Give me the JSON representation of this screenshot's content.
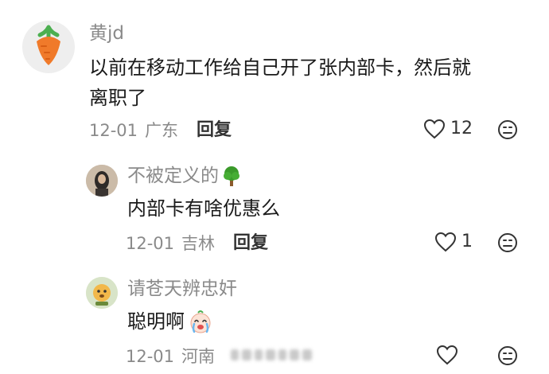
{
  "comments": [
    {
      "user": "黄jd",
      "text_line1": "以前在移动工作给自己开了张内部卡，然后就",
      "text_line2": "离职了",
      "date": "12-01",
      "location": "广东",
      "reply_label": "回复",
      "likes": "12"
    }
  ],
  "replies": [
    {
      "user": "不被定义的",
      "text": "内部卡有啥优惠么",
      "date": "12-01",
      "location": "吉林",
      "reply_label": "回复",
      "likes": "1"
    },
    {
      "user": "请苍天辨忠奸",
      "text": "聪明啊",
      "date": "12-01",
      "location": "河南",
      "likes": ""
    }
  ],
  "icons": {
    "like": "heart-outline-icon",
    "dislike": "sad-face-icon",
    "tree_badge": "tree-emoji",
    "cry_emoji": "crying-face-emoji",
    "carrot_avatar": "carrot-avatar"
  },
  "colors": {
    "text": "#1a1a1a",
    "meta": "#8a8a8a",
    "carrot": "#f07a2a",
    "tree": "#3a9a2a"
  }
}
